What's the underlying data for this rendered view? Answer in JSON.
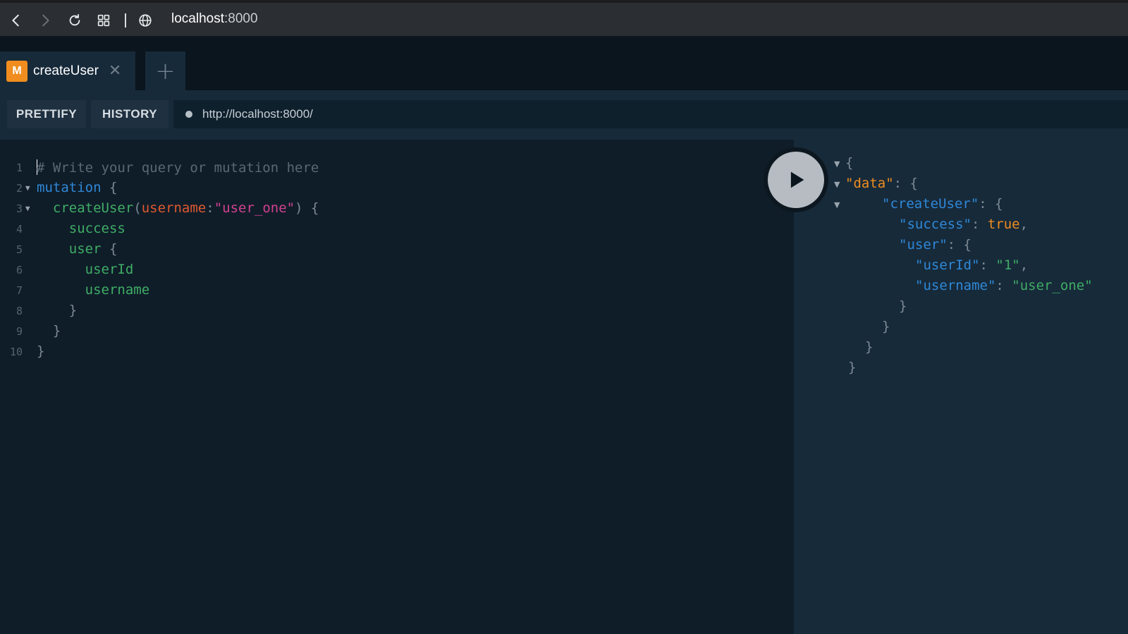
{
  "browser": {
    "host": "localhost",
    "port": ":8000"
  },
  "tab": {
    "badge": "M",
    "title": "createUser",
    "close": "✕",
    "add": "+"
  },
  "toolbar": {
    "prettify_label": "PRETTIFY",
    "history_label": "HISTORY",
    "endpoint": "http://localhost:8000/"
  },
  "editor": {
    "line_numbers": [
      "1",
      "2",
      "3",
      "4",
      "5",
      "6",
      "7",
      "8",
      "9",
      "10"
    ],
    "comment": "# Write your query or mutation here",
    "keyword": "mutation",
    "mutation_field": "createUser",
    "arg_name": "username",
    "arg_value": "\"user_one\"",
    "field_success": "success",
    "field_user": "user",
    "field_userId": "userId",
    "field_username": "username"
  },
  "result": {
    "key_data": "\"data\"",
    "key_createUser": "\"createUser\"",
    "key_success": "\"success\"",
    "val_success": "true",
    "key_user": "\"user\"",
    "key_userId": "\"userId\"",
    "val_userId": "\"1\"",
    "key_username": "\"username\"",
    "val_username": "\"user_one\""
  }
}
